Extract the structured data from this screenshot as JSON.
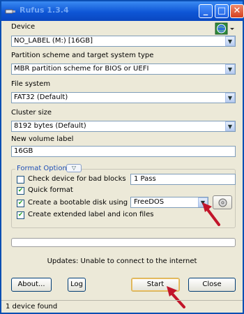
{
  "window": {
    "title": "Rufus 1.3.4",
    "minimize_glyph": "_",
    "maximize_glyph": "□",
    "close_glyph": "✕"
  },
  "device": {
    "label": "Device",
    "value": "NO_LABEL (M:) [16GB]"
  },
  "partition": {
    "label": "Partition scheme and target system type",
    "value": "MBR partition scheme for BIOS or UEFI"
  },
  "filesystem": {
    "label": "File system",
    "value": "FAT32 (Default)"
  },
  "cluster": {
    "label": "Cluster size",
    "value": "8192 bytes (Default)"
  },
  "volume": {
    "label": "New volume label",
    "value": "16GB"
  },
  "format_options": {
    "label": "Format Options",
    "toggle_glyph": "▽",
    "bad_blocks": {
      "label": "Check device for bad blocks",
      "checked": false,
      "passes": "1 Pass"
    },
    "quick_format": {
      "label": "Quick format",
      "checked": true
    },
    "bootable": {
      "label": "Create a bootable disk using",
      "checked": true,
      "source": "FreeDOS"
    },
    "extended": {
      "label": "Create extended label and icon files",
      "checked": true
    }
  },
  "progress": {
    "fraction": 0.0
  },
  "status_message": "Updates: Unable to connect to the internet",
  "buttons": {
    "about": "About...",
    "log": "Log",
    "start": "Start",
    "close": "Close"
  },
  "statusbar": "1 device found",
  "check_glyph": "✔",
  "dropdown_glyph": "▼",
  "colors": {
    "titlebar": "#0e56d6",
    "window_bg": "#ece9d8",
    "accent_link": "#1f4fb7",
    "check_mark": "#21a121",
    "annotation_arrow": "#c2152a"
  },
  "icons": [
    "usb-icon",
    "globe-settings-icon",
    "disk-image-icon"
  ]
}
